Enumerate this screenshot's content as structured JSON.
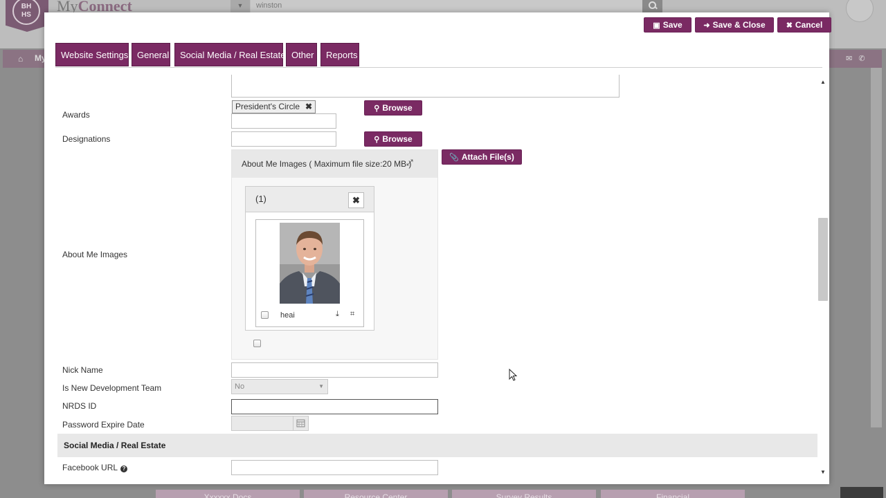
{
  "background": {
    "logo_text": "BH\nHS",
    "brand_pre": "My",
    "brand_bold": "Connect",
    "search_value": "winston",
    "nav_text": "My",
    "tiles": [
      "Xxxxxx Docs",
      "Resource Center",
      "Survey Results",
      "Financial"
    ]
  },
  "toolbar": {
    "save_label": "Save",
    "save_close_label": "Save & Close",
    "cancel_label": "Cancel"
  },
  "tabs": [
    "Website Settings",
    "General",
    "Social Media / Real Estate",
    "Other",
    "Reports"
  ],
  "form": {
    "awards_label": "Awards",
    "awards_tag": "President's Circle",
    "browse_label": "Browse",
    "designations_label": "Designations",
    "attach_label": "Attach File(s)",
    "about_images_label": "About Me Images",
    "about_images_header": "About Me Images ( Maximum file size:20 MB )",
    "image_card_count": "(1)",
    "image_filename": "heai",
    "nick_name_label": "Nick Name",
    "new_dev_label": "Is New Development Team",
    "new_dev_value": "No",
    "nrds_label": "NRDS ID",
    "password_expire_label": "Password Expire Date",
    "section_social": "Social Media / Real Estate",
    "facebook_label": "Facebook URL"
  }
}
